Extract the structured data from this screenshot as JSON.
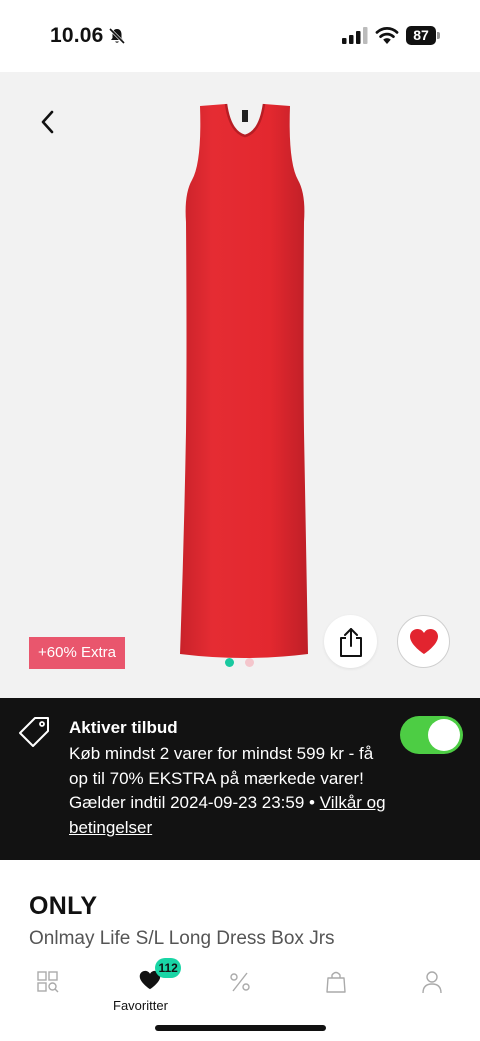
{
  "status_bar": {
    "time": "10.06",
    "battery": "87",
    "icons": [
      "bell-off-icon",
      "signal-icon",
      "wifi-icon",
      "battery-icon"
    ]
  },
  "product": {
    "brand": "ONLY",
    "title": "Onlmay Life S/L Long Dress Box Jrs",
    "promo_tag": "+60% Extra",
    "image_count": 2,
    "active_image": 1,
    "is_favorite": true
  },
  "offer": {
    "title": "Aktiver tilbud",
    "body": "Køb mindst 2 varer for mindst 599 kr - få op til 70% EKSTRA på mærkede varer! Gælder indtil 2024-09-23 23:59 •",
    "link": "Vilkår og betingelser",
    "enabled": true
  },
  "nav": {
    "items": [
      {
        "icon": "grid-search-icon",
        "label": ""
      },
      {
        "icon": "heart-icon",
        "label": "Favoritter",
        "badge": "112"
      },
      {
        "icon": "percent-icon",
        "label": ""
      },
      {
        "icon": "bag-icon",
        "label": ""
      },
      {
        "icon": "user-icon",
        "label": ""
      }
    ]
  },
  "colors": {
    "dress": "#e1282f",
    "promo": "#e9566d",
    "toggle_on": "#4dcd44",
    "badge": "#19d5a5",
    "heart": "#e2242f",
    "dot_active": "#19c9a0",
    "dot_inactive": "#f4c6cc"
  }
}
